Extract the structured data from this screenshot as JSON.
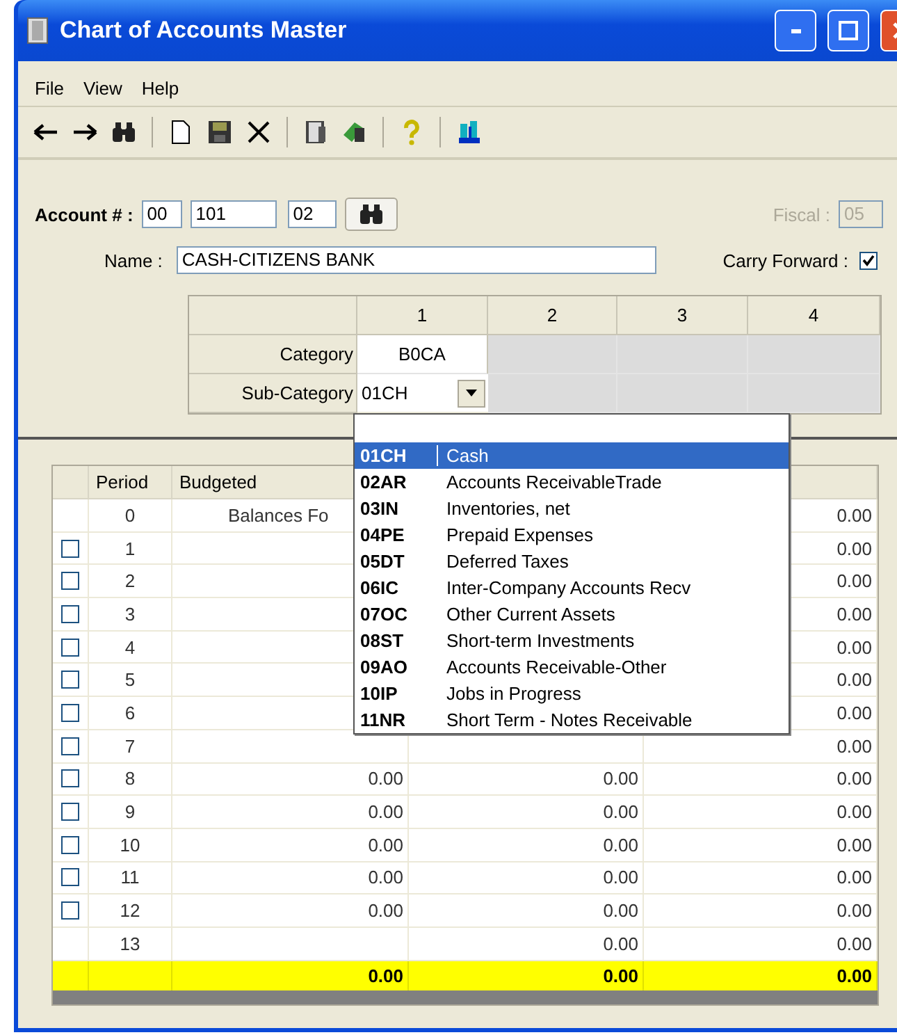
{
  "window": {
    "title": "Chart of Accounts Master"
  },
  "menu": [
    {
      "label": "File"
    },
    {
      "label": "View"
    },
    {
      "label": "Help"
    }
  ],
  "account": {
    "label": "Account # :",
    "segments": [
      "00",
      "101",
      "02"
    ],
    "fiscal_label": "Fiscal :",
    "fiscal_value": "05",
    "fiscal_disabled": true
  },
  "name": {
    "label": "Name :",
    "value": "CASH-CITIZENS BANK"
  },
  "carry_forward": {
    "label": "Carry Forward :",
    "checked": true
  },
  "category_grid": {
    "columns": [
      "1",
      "2",
      "3",
      "4"
    ],
    "rows": [
      {
        "label": "Category",
        "value": "B0CA",
        "kind": "text"
      },
      {
        "label": "Sub-Category",
        "value": "01CH",
        "kind": "combo"
      }
    ]
  },
  "table": {
    "columns": [
      "Period",
      "Budgeted"
    ],
    "rows": [
      {
        "period": "0",
        "kind": "plain",
        "budgeted": "Balances Fo",
        "column_4": "0.00"
      },
      {
        "period": "1",
        "kind": "check",
        "checked": false,
        "column_4": "0.00"
      },
      {
        "period": "2",
        "kind": "check",
        "checked": false,
        "column_4": "0.00"
      },
      {
        "period": "3",
        "kind": "check",
        "checked": false,
        "column_4": "0.00"
      },
      {
        "period": "4",
        "kind": "check",
        "checked": false,
        "column_4": "0.00"
      },
      {
        "period": "5",
        "kind": "check",
        "checked": false,
        "column_4": "0.00"
      },
      {
        "period": "6",
        "kind": "check",
        "checked": false,
        "column_4": "0.00"
      },
      {
        "period": "7",
        "kind": "check",
        "checked": false,
        "column_4": "0.00"
      },
      {
        "period": "8",
        "kind": "check",
        "checked": false,
        "budgeted": "0.00",
        "column_3": "0.00",
        "column_4": "0.00"
      },
      {
        "period": "9",
        "kind": "check",
        "checked": false,
        "budgeted": "0.00",
        "column_3": "0.00",
        "column_4": "0.00"
      },
      {
        "period": "10",
        "kind": "check",
        "checked": false,
        "budgeted": "0.00",
        "column_3": "0.00",
        "column_4": "0.00"
      },
      {
        "period": "11",
        "kind": "check",
        "checked": false,
        "budgeted": "0.00",
        "column_3": "0.00",
        "column_4": "0.00"
      },
      {
        "period": "12",
        "kind": "check",
        "checked": false,
        "budgeted": "0.00",
        "column_3": "0.00",
        "column_4": "0.00"
      },
      {
        "period": "13",
        "kind": "plain",
        "column_3": "0.00",
        "column_4": "0.00"
      }
    ],
    "totals": {
      "budgeted": "0.00",
      "column_3": "0.00",
      "column_4": "0.00"
    }
  },
  "dropdown": {
    "items": [
      {
        "code": "01CH",
        "label": "Cash",
        "selected": true
      },
      {
        "code": "02AR",
        "label": "Accounts ReceivableTrade",
        "selected": false
      },
      {
        "code": "03IN",
        "label": "Inventories, net",
        "selected": false
      },
      {
        "code": "04PE",
        "label": "Prepaid Expenses",
        "selected": false
      },
      {
        "code": "05DT",
        "label": "Deferred Taxes",
        "selected": false
      },
      {
        "code": "06IC",
        "label": "Inter-Company Accounts Recv",
        "selected": false
      },
      {
        "code": "07OC",
        "label": "Other Current Assets",
        "selected": false
      },
      {
        "code": "08ST",
        "label": "Short-term Investments",
        "selected": false
      },
      {
        "code": "09AO",
        "label": "Accounts Receivable-Other",
        "selected": false
      },
      {
        "code": "10IP",
        "label": "Jobs in Progress",
        "selected": false
      },
      {
        "code": "11NR",
        "label": "Short Term - Notes Receivable",
        "selected": false
      }
    ]
  }
}
